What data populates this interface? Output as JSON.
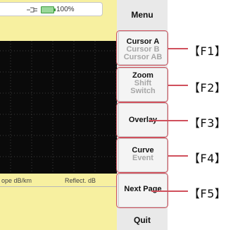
{
  "status": {
    "icons": [
      "plug-icon",
      "battery-icon"
    ],
    "battery": "100%"
  },
  "bottom": {
    "slope": "ope dB/km",
    "reflect": "Reflect. dB"
  },
  "menu": {
    "title": "Menu",
    "quit": "Quit",
    "buttons": [
      {
        "lines": [
          "Cursor A",
          "Cursor B",
          "Cursor AB"
        ]
      },
      {
        "lines": [
          "Zoom",
          "Shift",
          "Switch"
        ]
      },
      {
        "lines": [
          "Overlay"
        ]
      },
      {
        "lines": [
          "Curve",
          "Event"
        ]
      },
      {
        "lines": [
          "Next Page"
        ]
      }
    ]
  },
  "fkeys": [
    "【F1】",
    "【F2】",
    "【F3】",
    "【F4】",
    "【F5】"
  ],
  "colors": {
    "screen": "#f7f0a0",
    "plot": "#0a0a0a",
    "grid": "#3c3c3c",
    "highlight": "#d0505c"
  }
}
